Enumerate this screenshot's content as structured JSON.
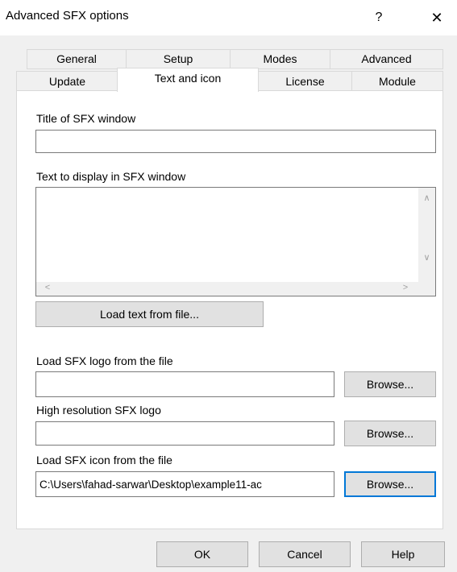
{
  "window": {
    "title": "Advanced SFX options",
    "help_symbol": "?",
    "close_symbol": "✕"
  },
  "tabs_row1": [
    {
      "label": "General"
    },
    {
      "label": "Setup"
    },
    {
      "label": "Modes"
    },
    {
      "label": "Advanced"
    }
  ],
  "tabs_row2": [
    {
      "label": "Update"
    },
    {
      "label": "Text and icon",
      "active": true
    },
    {
      "label": "License"
    },
    {
      "label": "Module"
    }
  ],
  "panel": {
    "title_label": "Title of SFX window",
    "title_value": "",
    "text_label": "Text to display in SFX window",
    "text_value": "",
    "load_text_button": "Load text from file...",
    "logo_label": "Load SFX logo from the file",
    "logo_value": "",
    "hires_logo_label": "High resolution SFX logo",
    "hires_logo_value": "",
    "icon_label": "Load SFX icon from the file",
    "icon_value": "C:\\Users\\fahad-sarwar\\Desktop\\example11-ac",
    "browse_label": "Browse..."
  },
  "footer": {
    "ok": "OK",
    "cancel": "Cancel",
    "help": "Help"
  },
  "scroll_arrows": {
    "up": "∧",
    "down": "∨",
    "left": "<",
    "right": ">"
  },
  "colors": {
    "focus_border": "#0078d7",
    "button_face": "#e1e1e1",
    "dialog_bg": "#f0f0f0"
  }
}
